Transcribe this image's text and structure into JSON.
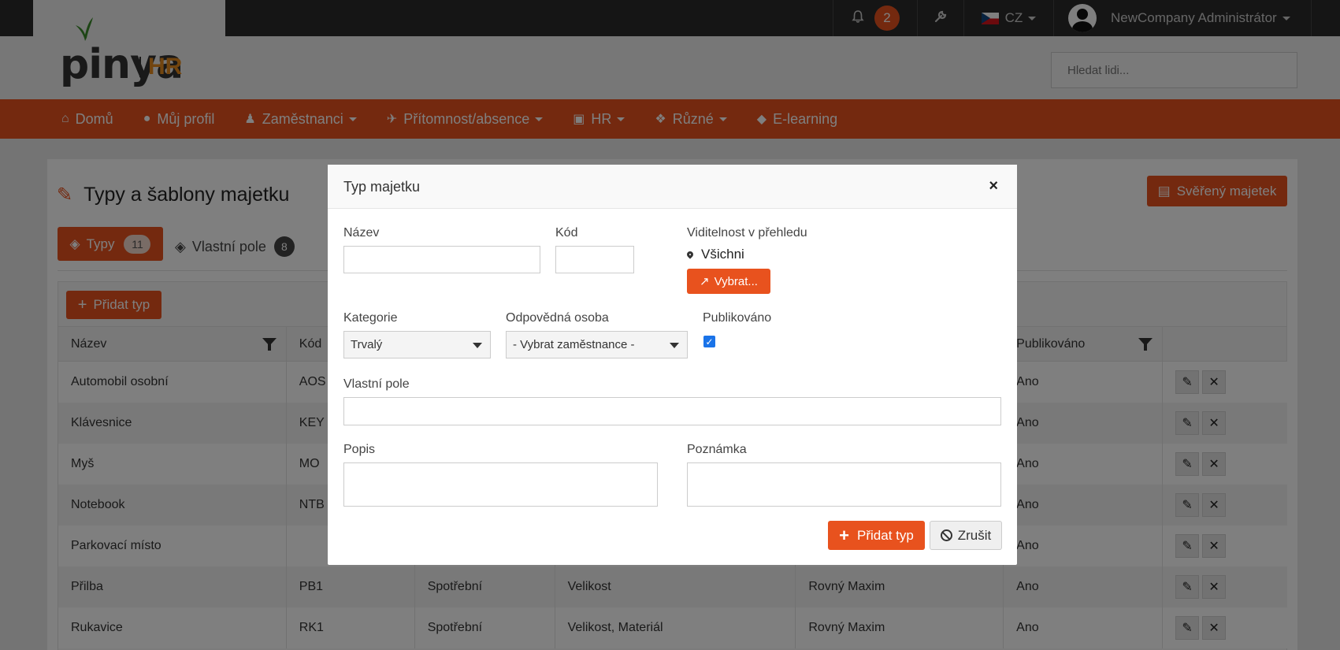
{
  "topbar": {
    "notifications_count": "2",
    "language": "CZ",
    "user_name": "NewCompany Administrátor"
  },
  "header": {
    "logo_main": "pinya",
    "logo_sub": "HR",
    "search_placeholder": "Hledat lidi..."
  },
  "nav": {
    "items": [
      {
        "label": "Domů",
        "icon": "home-icon"
      },
      {
        "label": "Můj profil",
        "icon": "user-circle-icon"
      },
      {
        "label": "Zaměstnanci",
        "icon": "users-icon"
      },
      {
        "label": "Přítomnost/absence",
        "icon": "plane-icon"
      },
      {
        "label": "HR",
        "icon": "id-badge-icon"
      },
      {
        "label": "Různé",
        "icon": "cubes-icon"
      },
      {
        "label": "E-learning",
        "icon": "graduation-cap-icon"
      }
    ]
  },
  "page": {
    "title": "Typy a šablony majetku",
    "entrusted_button": "Svěřený majetek",
    "tabs": [
      {
        "label": "Typy",
        "count": "11"
      },
      {
        "label": "Vlastní pole",
        "count": "8"
      }
    ],
    "add_type_button": "Přidat typ"
  },
  "grid": {
    "columns": [
      "Název",
      "Kód",
      "",
      "",
      "",
      "Publikováno",
      ""
    ],
    "rows": [
      {
        "name": "Automobil osobní",
        "code": "AOS",
        "category": "",
        "fields": "",
        "person": "",
        "published": "Ano"
      },
      {
        "name": "Klávesnice",
        "code": "KEY",
        "category": "",
        "fields": "",
        "person": "",
        "published": "Ano"
      },
      {
        "name": "Myš",
        "code": "MO",
        "category": "",
        "fields": "",
        "person": "",
        "published": "Ano"
      },
      {
        "name": "Notebook",
        "code": "NTB",
        "category": "",
        "fields": "",
        "person": "",
        "published": "Ano"
      },
      {
        "name": "Parkovací místo",
        "code": "",
        "category": "",
        "fields": "",
        "person": "",
        "published": "Ano"
      },
      {
        "name": "Přilba",
        "code": "PB1",
        "category": "Spotřební",
        "fields": "Velikost",
        "person": "Rovný Maxim",
        "published": "Ano"
      },
      {
        "name": "Rukavice",
        "code": "RK1",
        "category": "Spotřební",
        "fields": "Velikost, Materiál",
        "person": "Rovný Maxim",
        "published": "Ano"
      }
    ]
  },
  "modal": {
    "title": "Typ majetku",
    "close_glyph": "×",
    "fields": {
      "name_label": "Název",
      "code_label": "Kód",
      "visibility_label": "Viditelnost v přehledu",
      "visibility_value": "Všichni",
      "select_button": "Vybrat...",
      "category_label": "Kategorie",
      "category_value": "Trvalý",
      "responsible_label": "Odpovědná osoba",
      "responsible_value": "- Vybrat zaměstnance -",
      "published_label": "Publikováno",
      "published_checked": true,
      "custom_fields_label": "Vlastní pole",
      "description_label": "Popis",
      "note_label": "Poznámka"
    },
    "submit_button": "Přidat typ",
    "cancel_button": "Zrušit"
  },
  "colors": {
    "accent": "#e8521e",
    "topbar": "#2b2b2b"
  }
}
